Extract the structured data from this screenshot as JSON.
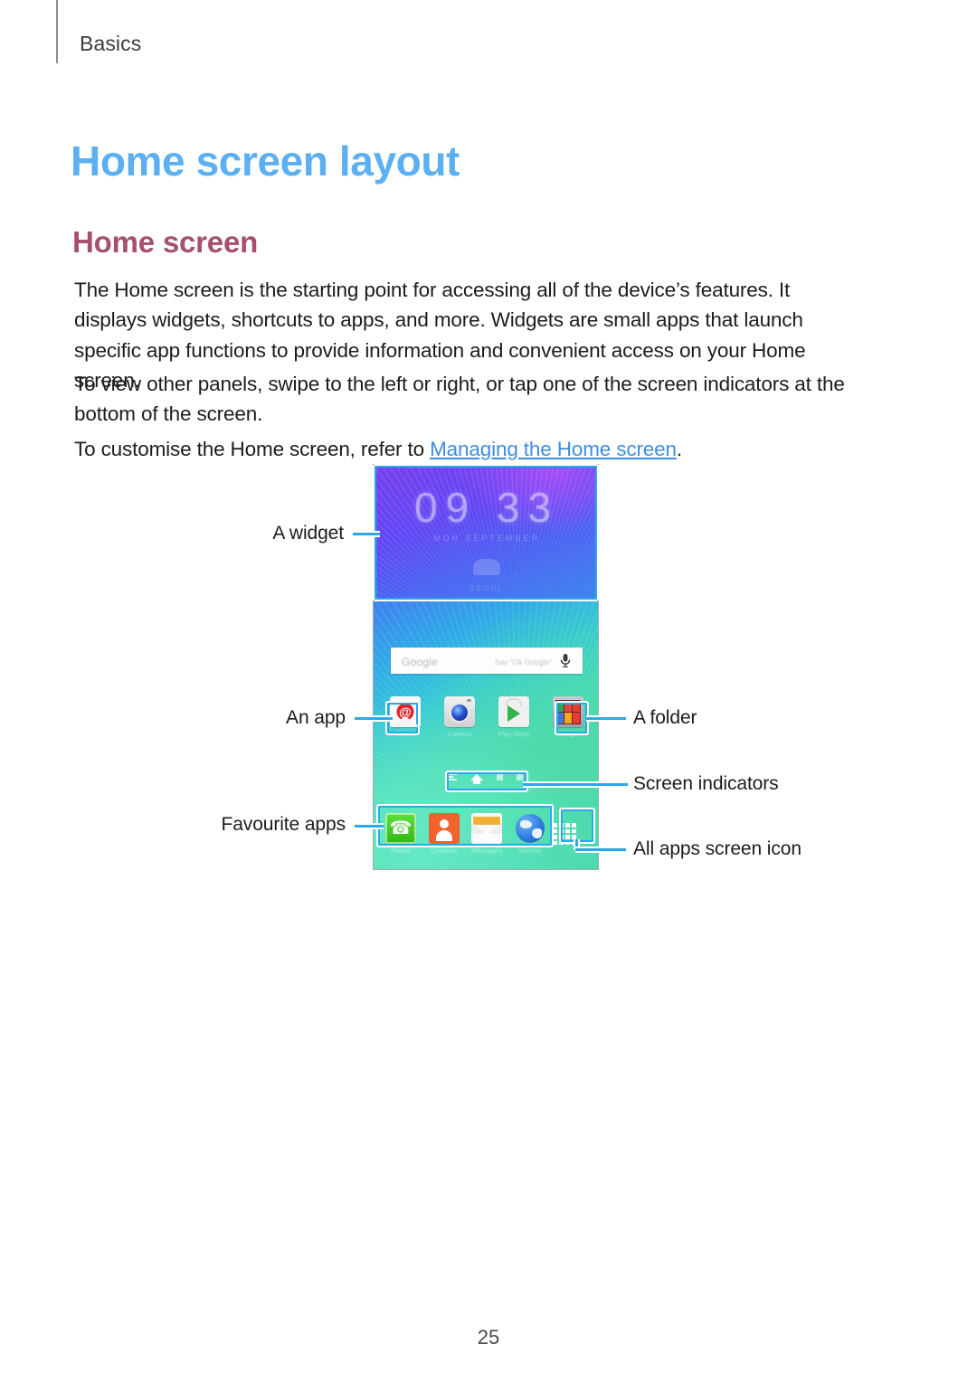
{
  "page": {
    "running_head": "Basics",
    "chapter_title": "Home screen layout",
    "section_title": "Home screen",
    "page_number": "25"
  },
  "paragraphs": {
    "p1": "The Home screen is the starting point for accessing all of the device’s features. It displays widgets, shortcuts to apps, and more. Widgets are small apps that launch specific app functions to provide information and convenient access on your Home screen.",
    "p2": "To view other panels, swipe to the left or right, or tap one of the screen indicators at the bottom of the screen.",
    "p3_before": "To customise the Home screen, refer to ",
    "p3_link": "Managing the Home screen",
    "p3_after": "."
  },
  "figure": {
    "callouts": {
      "widget": "A widget",
      "app": "An app",
      "favourite_apps": "Favourite apps",
      "folder": "A folder",
      "screen_indicators": "Screen indicators",
      "all_apps": "All apps screen icon"
    },
    "widget": {
      "hours": "09",
      "minutes": "33",
      "subtitle": "MON   SEPTEMBER",
      "location": "SEOUL"
    },
    "search_bar": {
      "wordmark": "Google",
      "hint": "Say “Ok Google”",
      "mic_icon": "microphone-icon"
    },
    "app_row": [
      {
        "label": "Email",
        "icon": "email-icon"
      },
      {
        "label": "Camera",
        "icon": "camera-icon"
      },
      {
        "label": "Play Store",
        "icon": "play-store-icon"
      },
      {
        "label": "Google",
        "icon": "folder-icon"
      }
    ],
    "folder_contents": [
      "#2fa84f",
      "#d94a3c",
      "#e0402f",
      "#3f7ad6",
      "#f2a81e",
      "#e33b34"
    ],
    "screen_indicators": [
      {
        "type": "flipboard-indicator",
        "active": false
      },
      {
        "type": "home-indicator",
        "active": true
      },
      {
        "type": "panel-indicator",
        "active": false
      },
      {
        "type": "panel-indicator",
        "active": false
      }
    ],
    "dock_apps": [
      {
        "label": "Phone",
        "icon": "phone-icon"
      },
      {
        "label": "Contacts",
        "icon": "contacts-icon"
      },
      {
        "label": "Messages",
        "icon": "messages-icon"
      },
      {
        "label": "Internet",
        "icon": "internet-icon"
      }
    ],
    "all_apps_icon": "apps-grid-icon"
  },
  "colors": {
    "chapter_title": "#5cb0f2",
    "section_title": "#a6506d",
    "link": "#3e8ede",
    "callout_outline": "#29a9e8",
    "body_text": "#1c1c1c"
  }
}
